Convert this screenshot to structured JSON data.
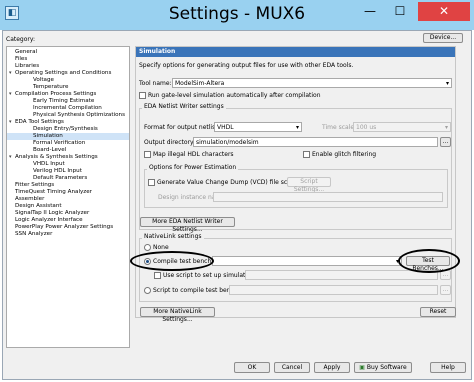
{
  "window": {
    "title": "Settings - MUX6",
    "minimize": "—",
    "maximize": "☐",
    "close": "✕"
  },
  "category_label": "Category:",
  "device_button": "Device...",
  "categories": [
    {
      "label": "General",
      "indent": 0,
      "arrow": ""
    },
    {
      "label": "Files",
      "indent": 0,
      "arrow": ""
    },
    {
      "label": "Libraries",
      "indent": 0,
      "arrow": ""
    },
    {
      "label": "Operating Settings and Conditions",
      "indent": 0,
      "arrow": "▾"
    },
    {
      "label": "Voltage",
      "indent": 1,
      "arrow": ""
    },
    {
      "label": "Temperature",
      "indent": 1,
      "arrow": ""
    },
    {
      "label": "Compilation Process Settings",
      "indent": 0,
      "arrow": "▾"
    },
    {
      "label": "Early Timing Estimate",
      "indent": 1,
      "arrow": ""
    },
    {
      "label": "Incremental Compilation",
      "indent": 1,
      "arrow": ""
    },
    {
      "label": "Physical Synthesis Optimizations",
      "indent": 1,
      "arrow": ""
    },
    {
      "label": "EDA Tool Settings",
      "indent": 0,
      "arrow": "▾"
    },
    {
      "label": "Design Entry/Synthesis",
      "indent": 1,
      "arrow": ""
    },
    {
      "label": "Simulation",
      "indent": 1,
      "arrow": "",
      "selected": true
    },
    {
      "label": "Formal Verification",
      "indent": 1,
      "arrow": ""
    },
    {
      "label": "Board-Level",
      "indent": 1,
      "arrow": ""
    },
    {
      "label": "Analysis & Synthesis Settings",
      "indent": 0,
      "arrow": "▾"
    },
    {
      "label": "VHDL Input",
      "indent": 1,
      "arrow": ""
    },
    {
      "label": "Verilog HDL Input",
      "indent": 1,
      "arrow": ""
    },
    {
      "label": "Default Parameters",
      "indent": 1,
      "arrow": ""
    },
    {
      "label": "Fitter Settings",
      "indent": 0,
      "arrow": ""
    },
    {
      "label": "TimeQuest Timing Analyzer",
      "indent": 0,
      "arrow": ""
    },
    {
      "label": "Assembler",
      "indent": 0,
      "arrow": ""
    },
    {
      "label": "Design Assistant",
      "indent": 0,
      "arrow": ""
    },
    {
      "label": "SignalTap II Logic Analyzer",
      "indent": 0,
      "arrow": ""
    },
    {
      "label": "Logic Analyzer Interface",
      "indent": 0,
      "arrow": ""
    },
    {
      "label": "PowerPlay Power Analyzer Settings",
      "indent": 0,
      "arrow": ""
    },
    {
      "label": "SSN Analyzer",
      "indent": 0,
      "arrow": ""
    }
  ],
  "sim": {
    "header": "Simulation",
    "description": "Specify options for generating output files for use with other EDA tools.",
    "tool_name_label": "Tool name:",
    "tool_name_value": "ModelSim-Altera",
    "gate_level_label": "Run gate-level simulation automatically after compilation",
    "netlist_group": "EDA Netlist Writer settings",
    "format_label": "Format for output netlist:",
    "format_value": "VHDL",
    "time_scale_label": "Time scale:",
    "time_scale_value": "100 us",
    "output_dir_label": "Output directory:",
    "output_dir_value": "simulation/modelsim",
    "browse": "...",
    "map_illegal_label": "Map illegal HDL characters",
    "glitch_label": "Enable glitch filtering",
    "power_group": "Options for Power Estimation",
    "vcd_label": "Generate Value Change Dump (VCD) file script",
    "script_settings": "Script Settings...",
    "design_instance_label": "Design instance name:",
    "more_netlist": "More EDA Netlist Writer Settings...",
    "nativelink_group": "NativeLink settings",
    "none_label": "None",
    "compile_tb_label": "Compile test bench:",
    "test_benches": "Test Benches...",
    "use_script_label": "Use script to set up simulation:",
    "script_compile_label": "Script to compile test bench:",
    "more_nativelink": "More NativeLink Settings...",
    "reset": "Reset"
  },
  "footer": {
    "ok": "OK",
    "cancel": "Cancel",
    "apply": "Apply",
    "buy": "Buy Software",
    "help": "Help"
  }
}
